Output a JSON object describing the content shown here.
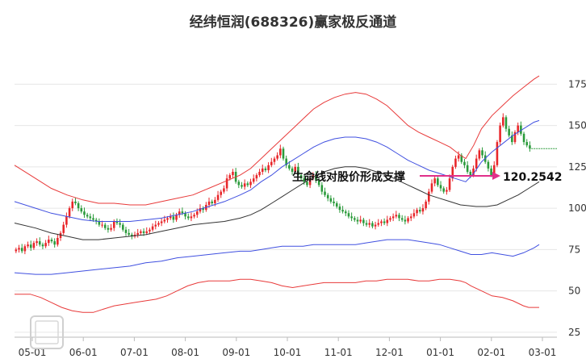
{
  "chart_data": {
    "type": "line",
    "title": "经纬恒润(688326)赢家极反通道",
    "x_tick_labels": [
      "05-01",
      "06-01",
      "07-01",
      "08-01",
      "09-01",
      "10-01",
      "11-01",
      "12-01",
      "01-01",
      "02-01",
      "03-01"
    ],
    "y_ticks": [
      25,
      50,
      75,
      100,
      125,
      150,
      175
    ],
    "ylim": [
      22,
      182
    ],
    "grid": "horizontal",
    "annotation": {
      "text": "生命线对股价形成支撑",
      "value_label": "120.2542",
      "value": 120.2542,
      "arrow_color": "#e0308a"
    },
    "colors": {
      "up_candle": "#e8262a",
      "down_candle": "#2a9a3a",
      "upper_band": "#e83a3a",
      "mid_upper_band": "#4050e0",
      "life_line": "#333333",
      "mid_lower_band": "#4050e0",
      "lower_band": "#e83a3a",
      "last_price_line": "#2a9a3a"
    },
    "series": [
      {
        "key": "upper_band",
        "values": [
          [
            0,
            126
          ],
          [
            8,
            118
          ],
          [
            14,
            112
          ],
          [
            20,
            108
          ],
          [
            26,
            105
          ],
          [
            32,
            103
          ],
          [
            38,
            103
          ],
          [
            44,
            102
          ],
          [
            50,
            102
          ],
          [
            56,
            104
          ],
          [
            62,
            106
          ],
          [
            68,
            108
          ],
          [
            74,
            112
          ],
          [
            80,
            116
          ],
          [
            86,
            120
          ],
          [
            90,
            124
          ],
          [
            94,
            130
          ],
          [
            98,
            136
          ],
          [
            102,
            142
          ],
          [
            106,
            148
          ],
          [
            110,
            154
          ],
          [
            114,
            160
          ],
          [
            118,
            164
          ],
          [
            122,
            167
          ],
          [
            126,
            169
          ],
          [
            130,
            170
          ],
          [
            134,
            169
          ],
          [
            138,
            166
          ],
          [
            142,
            162
          ],
          [
            146,
            156
          ],
          [
            150,
            150
          ],
          [
            154,
            146
          ],
          [
            158,
            143
          ],
          [
            162,
            140
          ],
          [
            166,
            137
          ],
          [
            170,
            132
          ],
          [
            172,
            130
          ],
          [
            175,
            138
          ],
          [
            178,
            148
          ],
          [
            182,
            156
          ],
          [
            186,
            162
          ],
          [
            190,
            168
          ],
          [
            194,
            173
          ],
          [
            198,
            178
          ],
          [
            200,
            180
          ]
        ]
      },
      {
        "key": "mid_upper_band",
        "values": [
          [
            0,
            104
          ],
          [
            8,
            100
          ],
          [
            14,
            97
          ],
          [
            20,
            95
          ],
          [
            26,
            93
          ],
          [
            32,
            92
          ],
          [
            38,
            92
          ],
          [
            44,
            92
          ],
          [
            50,
            93
          ],
          [
            56,
            94
          ],
          [
            62,
            96
          ],
          [
            68,
            98
          ],
          [
            74,
            101
          ],
          [
            80,
            104
          ],
          [
            86,
            108
          ],
          [
            90,
            111
          ],
          [
            94,
            116
          ],
          [
            98,
            120
          ],
          [
            102,
            125
          ],
          [
            106,
            129
          ],
          [
            110,
            133
          ],
          [
            114,
            137
          ],
          [
            118,
            140
          ],
          [
            122,
            142
          ],
          [
            126,
            143
          ],
          [
            130,
            143
          ],
          [
            134,
            142
          ],
          [
            138,
            140
          ],
          [
            142,
            137
          ],
          [
            146,
            133
          ],
          [
            150,
            129
          ],
          [
            154,
            126
          ],
          [
            158,
            123
          ],
          [
            162,
            121
          ],
          [
            166,
            119
          ],
          [
            170,
            117
          ],
          [
            172,
            116
          ],
          [
            175,
            121
          ],
          [
            178,
            128
          ],
          [
            182,
            134
          ],
          [
            186,
            139
          ],
          [
            190,
            144
          ],
          [
            194,
            148
          ],
          [
            198,
            152
          ],
          [
            200,
            153
          ]
        ]
      },
      {
        "key": "life_line",
        "values": [
          [
            0,
            91
          ],
          [
            8,
            88
          ],
          [
            14,
            85
          ],
          [
            20,
            83
          ],
          [
            26,
            81
          ],
          [
            32,
            81
          ],
          [
            38,
            82
          ],
          [
            44,
            83
          ],
          [
            50,
            84
          ],
          [
            56,
            86
          ],
          [
            62,
            88
          ],
          [
            68,
            90
          ],
          [
            74,
            91
          ],
          [
            80,
            92
          ],
          [
            86,
            94
          ],
          [
            90,
            96
          ],
          [
            94,
            99
          ],
          [
            98,
            103
          ],
          [
            102,
            107
          ],
          [
            106,
            111
          ],
          [
            110,
            115
          ],
          [
            114,
            119
          ],
          [
            118,
            122
          ],
          [
            122,
            124
          ],
          [
            126,
            125
          ],
          [
            130,
            125
          ],
          [
            134,
            124
          ],
          [
            138,
            122
          ],
          [
            142,
            120
          ],
          [
            146,
            117
          ],
          [
            150,
            114
          ],
          [
            154,
            111
          ],
          [
            158,
            108
          ],
          [
            162,
            106
          ],
          [
            166,
            104
          ],
          [
            170,
            102
          ],
          [
            176,
            101
          ],
          [
            180,
            101
          ],
          [
            184,
            102
          ],
          [
            188,
            105
          ],
          [
            192,
            108
          ],
          [
            196,
            112
          ],
          [
            200,
            116
          ]
        ]
      },
      {
        "key": "mid_lower_band",
        "values": [
          [
            0,
            61
          ],
          [
            8,
            60
          ],
          [
            14,
            60
          ],
          [
            20,
            61
          ],
          [
            26,
            62
          ],
          [
            32,
            63
          ],
          [
            38,
            64
          ],
          [
            44,
            65
          ],
          [
            50,
            67
          ],
          [
            56,
            68
          ],
          [
            62,
            70
          ],
          [
            68,
            71
          ],
          [
            74,
            72
          ],
          [
            80,
            73
          ],
          [
            86,
            74
          ],
          [
            90,
            74
          ],
          [
            94,
            75
          ],
          [
            98,
            76
          ],
          [
            102,
            77
          ],
          [
            106,
            77
          ],
          [
            110,
            77
          ],
          [
            114,
            78
          ],
          [
            118,
            78
          ],
          [
            122,
            78
          ],
          [
            126,
            78
          ],
          [
            130,
            78
          ],
          [
            134,
            79
          ],
          [
            138,
            80
          ],
          [
            142,
            81
          ],
          [
            146,
            81
          ],
          [
            150,
            81
          ],
          [
            154,
            80
          ],
          [
            158,
            79
          ],
          [
            162,
            78
          ],
          [
            166,
            76
          ],
          [
            170,
            74
          ],
          [
            174,
            72
          ],
          [
            178,
            72
          ],
          [
            182,
            73
          ],
          [
            186,
            72
          ],
          [
            190,
            71
          ],
          [
            194,
            73
          ],
          [
            198,
            76
          ],
          [
            200,
            78
          ]
        ]
      },
      {
        "key": "lower_band",
        "values": [
          [
            0,
            48
          ],
          [
            6,
            48
          ],
          [
            10,
            46
          ],
          [
            14,
            43
          ],
          [
            18,
            40
          ],
          [
            22,
            38
          ],
          [
            26,
            37
          ],
          [
            30,
            37
          ],
          [
            34,
            39
          ],
          [
            38,
            41
          ],
          [
            42,
            42
          ],
          [
            46,
            43
          ],
          [
            50,
            44
          ],
          [
            54,
            45
          ],
          [
            58,
            47
          ],
          [
            62,
            50
          ],
          [
            66,
            53
          ],
          [
            70,
            55
          ],
          [
            74,
            56
          ],
          [
            78,
            56
          ],
          [
            82,
            56
          ],
          [
            86,
            57
          ],
          [
            90,
            57
          ],
          [
            94,
            56
          ],
          [
            98,
            55
          ],
          [
            102,
            53
          ],
          [
            106,
            52
          ],
          [
            110,
            53
          ],
          [
            114,
            54
          ],
          [
            118,
            55
          ],
          [
            122,
            55
          ],
          [
            126,
            55
          ],
          [
            130,
            55
          ],
          [
            134,
            56
          ],
          [
            138,
            56
          ],
          [
            142,
            57
          ],
          [
            146,
            57
          ],
          [
            150,
            57
          ],
          [
            154,
            56
          ],
          [
            158,
            56
          ],
          [
            162,
            57
          ],
          [
            166,
            57
          ],
          [
            170,
            56
          ],
          [
            172,
            55
          ],
          [
            174,
            53
          ],
          [
            178,
            50
          ],
          [
            182,
            47
          ],
          [
            186,
            46
          ],
          [
            190,
            44
          ],
          [
            194,
            41
          ],
          [
            196,
            40
          ],
          [
            200,
            40
          ]
        ]
      }
    ],
    "close": [
      75,
      76,
      74,
      77,
      78,
      76,
      79,
      80,
      78,
      77,
      79,
      81,
      80,
      78,
      82,
      85,
      90,
      95,
      100,
      104,
      103,
      100,
      98,
      96,
      95,
      94,
      93,
      92,
      90,
      90,
      88,
      87,
      88,
      92,
      91,
      90,
      87,
      85,
      84,
      83,
      84,
      85,
      86,
      85,
      86,
      87,
      89,
      90,
      91,
      92,
      93,
      94,
      95,
      93,
      96,
      98,
      97,
      95,
      94,
      95,
      96,
      98,
      100,
      99,
      102,
      104,
      103,
      105,
      108,
      110,
      112,
      118,
      120,
      122,
      116,
      114,
      113,
      115,
      114,
      116,
      118,
      120,
      122,
      124,
      123,
      126,
      128,
      130,
      132,
      136,
      130,
      126,
      124,
      122,
      125,
      120,
      118,
      116,
      114,
      118,
      120,
      117,
      114,
      110,
      108,
      106,
      104,
      103,
      101,
      99,
      98,
      97,
      95,
      94,
      93,
      92,
      93,
      91,
      90,
      91,
      89,
      90,
      91,
      92,
      91,
      93,
      94,
      95,
      96,
      94,
      93,
      92,
      94,
      95,
      97,
      99,
      98,
      100,
      104,
      110,
      115,
      118,
      114,
      112,
      110,
      111,
      118,
      125,
      130,
      132,
      128,
      126,
      122,
      120,
      124,
      130,
      135,
      132,
      128,
      124,
      120,
      126,
      140,
      150,
      155,
      148,
      144,
      140,
      146,
      150,
      145,
      140,
      138,
      136
    ]
  }
}
